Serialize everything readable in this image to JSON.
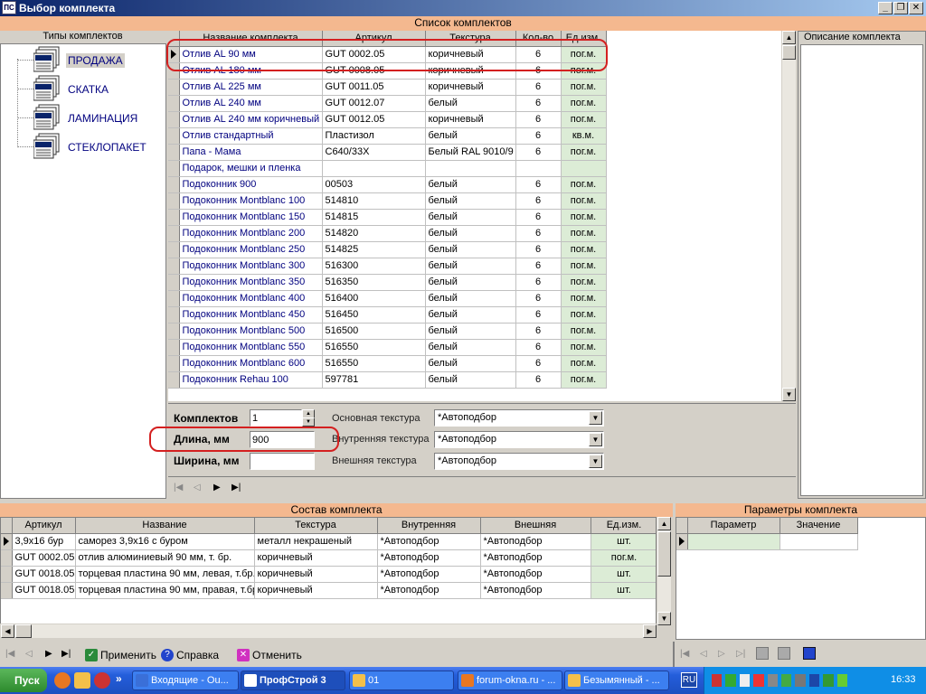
{
  "window": {
    "title": "Выбор комплекта",
    "icon_text": "ПС"
  },
  "headers": {
    "list": "Список комплектов",
    "types": "Типы комплектов",
    "description": "Описание комплекта",
    "composition": "Состав комплекта",
    "params": "Параметры комплекта"
  },
  "tree": [
    {
      "label": "ПРОДАЖА",
      "selected": true
    },
    {
      "label": "СКАТКА"
    },
    {
      "label": "ЛАМИНАЦИЯ"
    },
    {
      "label": "СТЕКЛОПАКЕТ"
    }
  ],
  "kits": {
    "columns": [
      "Название комплекта",
      "Артикул",
      "Текстура",
      "Кол-во",
      "Ед.изм."
    ],
    "rows": [
      [
        "Отлив AL  90 мм",
        "GUT 0002.05",
        "коричневый",
        "6",
        "пог.м."
      ],
      [
        "Отлив AL 180 мм",
        "GUT 0008.05",
        "коричневый",
        "6",
        "пог.м."
      ],
      [
        "Отлив AL 225 мм",
        "GUT 0011.05",
        "коричневый",
        "6",
        "пог.м."
      ],
      [
        "Отлив AL 240 мм",
        "GUT 0012.07",
        "белый",
        "6",
        "пог.м."
      ],
      [
        "Отлив AL 240 мм коричневый",
        "GUT 0012.05",
        "коричневый",
        "6",
        "пог.м."
      ],
      [
        "Отлив стандартный",
        "Пластизол",
        "белый",
        "6",
        "кв.м."
      ],
      [
        "Папа - Мама",
        "С640/33Х",
        "Белый RAL 9010/9",
        "6",
        "пог.м."
      ],
      [
        "Подарок, мешки и пленка",
        "",
        "",
        "",
        ""
      ],
      [
        "Подоконник 900",
        "00503",
        "белый",
        "6",
        "пог.м."
      ],
      [
        "Подоконник Montblanc 100",
        "514810",
        "белый",
        "6",
        "пог.м."
      ],
      [
        "Подоконник Montblanc 150",
        "514815",
        "белый",
        "6",
        "пог.м."
      ],
      [
        "Подоконник Montblanc 200",
        "514820",
        "белый",
        "6",
        "пог.м."
      ],
      [
        "Подоконник Montblanc 250",
        "514825",
        "белый",
        "6",
        "пог.м."
      ],
      [
        "Подоконник Montblanc 300",
        "516300",
        "белый",
        "6",
        "пог.м."
      ],
      [
        "Подоконник Montblanc 350",
        "516350",
        "белый",
        "6",
        "пог.м."
      ],
      [
        "Подоконник Montblanc 400",
        "516400",
        "белый",
        "6",
        "пог.м."
      ],
      [
        "Подоконник Montblanc 450",
        "516450",
        "белый",
        "6",
        "пог.м."
      ],
      [
        "Подоконник Montblanc 500",
        "516500",
        "белый",
        "6",
        "пог.м."
      ],
      [
        "Подоконник Montblanc 550",
        "516550",
        "белый",
        "6",
        "пог.м."
      ],
      [
        "Подоконник Montblanc 600",
        "516550",
        "белый",
        "6",
        "пог.м."
      ],
      [
        "Подоконник Rehau 100",
        "597781",
        "белый",
        "6",
        "пог.м."
      ]
    ]
  },
  "form": {
    "kits_label": "Комплектов",
    "kits_value": "1",
    "length_label": "Длина, мм",
    "length_value": "900",
    "width_label": "Ширина, мм",
    "width_value": "",
    "main_texture_label": "Основная текстура",
    "main_texture_value": "*Автоподбор",
    "inner_texture_label": "Внутренняя текстура",
    "inner_texture_value": "*Автоподбор",
    "outer_texture_label": "Внешняя текстура",
    "outer_texture_value": "*Автоподбор"
  },
  "composition": {
    "columns": [
      "Артикул",
      "Название",
      "Текстура",
      "Внутренняя",
      "Внешняя",
      "Ед.изм."
    ],
    "rows": [
      [
        "3,9х16 бур",
        "саморез 3,9х16 с буром",
        "металл некрашеный",
        "*Автоподбор",
        "*Автоподбор",
        "шт."
      ],
      [
        "GUT 0002.05",
        "отлив алюминиевый 90 мм, т. бр.",
        "коричневый",
        "*Автоподбор",
        "*Автоподбор",
        "пог.м."
      ],
      [
        "GUT 0018.05",
        "торцевая пластина 90 мм, левая, т.бр.",
        "коричневый",
        "*Автоподбор",
        "*Автоподбор",
        "шт."
      ],
      [
        "GUT 0018.05",
        "торцевая пластина 90 мм, правая, т.бр.",
        "коричневый",
        "*Автоподбор",
        "*Автоподбор",
        "шт."
      ]
    ]
  },
  "params": {
    "columns": [
      "Параметр",
      "Значение"
    ]
  },
  "buttons": {
    "apply": "Применить",
    "help": "Справка",
    "cancel": "Отменить"
  },
  "taskbar": {
    "start": "Пуск",
    "tasks": [
      "Входящие - Ou...",
      "ПрофСтрой 3",
      "01",
      "forum-okna.ru - ...",
      "Безымянный - ..."
    ],
    "lang": "RU",
    "clock": "16:33"
  },
  "colors": {
    "header": "#f4b88f",
    "unit_cell": "#dcecd6",
    "highlight": "#d42020"
  }
}
